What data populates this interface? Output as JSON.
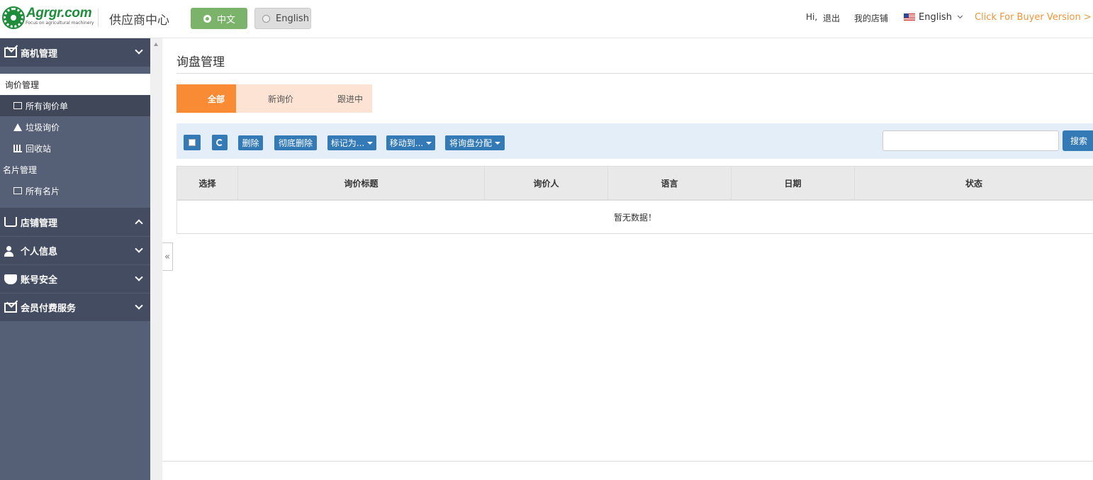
{
  "header": {
    "logo_text": "Agrgr.com",
    "logo_tagline": "Focus on agricultural machinery",
    "center_title": "供应商中心",
    "lang_options": [
      "中文",
      "English"
    ],
    "lang_selected": "中文",
    "greeting": "Hi,",
    "logout": "退出",
    "my_store": "我的店铺",
    "language_menu": "English",
    "buyer_link": "Click For Buyer Version >",
    "colors": {
      "accent_orange": "#f0953a",
      "brand_green": "#1e8c3a",
      "lang_active": "#7cb36a"
    }
  },
  "sidebar": {
    "groups": [
      {
        "label": "商机管理",
        "icon": "envelope-icon",
        "expanded": true
      },
      {
        "label": "店铺管理",
        "icon": "shop-cart-icon",
        "expanded": true
      },
      {
        "label": "个人信息",
        "icon": "user-lock-icon",
        "expanded": false
      },
      {
        "label": "账号安全",
        "icon": "shield-check-icon",
        "expanded": false
      },
      {
        "label": "会员付费服务",
        "icon": "envelope-icon",
        "expanded": false
      }
    ],
    "items": {
      "inquiry_manage": "询价管理",
      "all_inquiries": "所有询价单",
      "spam_inquiries": "垃圾询价",
      "recycle_bin": "回收站",
      "card_manage": "名片管理",
      "all_cards": "所有名片"
    },
    "colors": {
      "bg": "#555f76",
      "group_bg": "#444c61"
    }
  },
  "collapse_glyph": "«",
  "main": {
    "page_title": "询盘管理",
    "tabs": [
      {
        "label": "全部",
        "active": true
      },
      {
        "label": "新询价",
        "active": false
      },
      {
        "label": "跟进中",
        "active": false
      }
    ],
    "toolbar": {
      "delete": "删除",
      "delete_forever": "彻底删除",
      "mark_as": "标记为...",
      "move_to": "移动到...",
      "assign": "将询盘分配",
      "search_value": "",
      "search_button": "搜索"
    },
    "table": {
      "columns": [
        "选择",
        "询价标题",
        "询价人",
        "语言",
        "日期",
        "状态"
      ],
      "empty_text": "暂无数据！"
    },
    "colors": {
      "tab_active": "#f98b35",
      "tab_bg": "#fde3d3",
      "button": "#337ab7",
      "toolbar_bg": "#e4eef8"
    }
  }
}
